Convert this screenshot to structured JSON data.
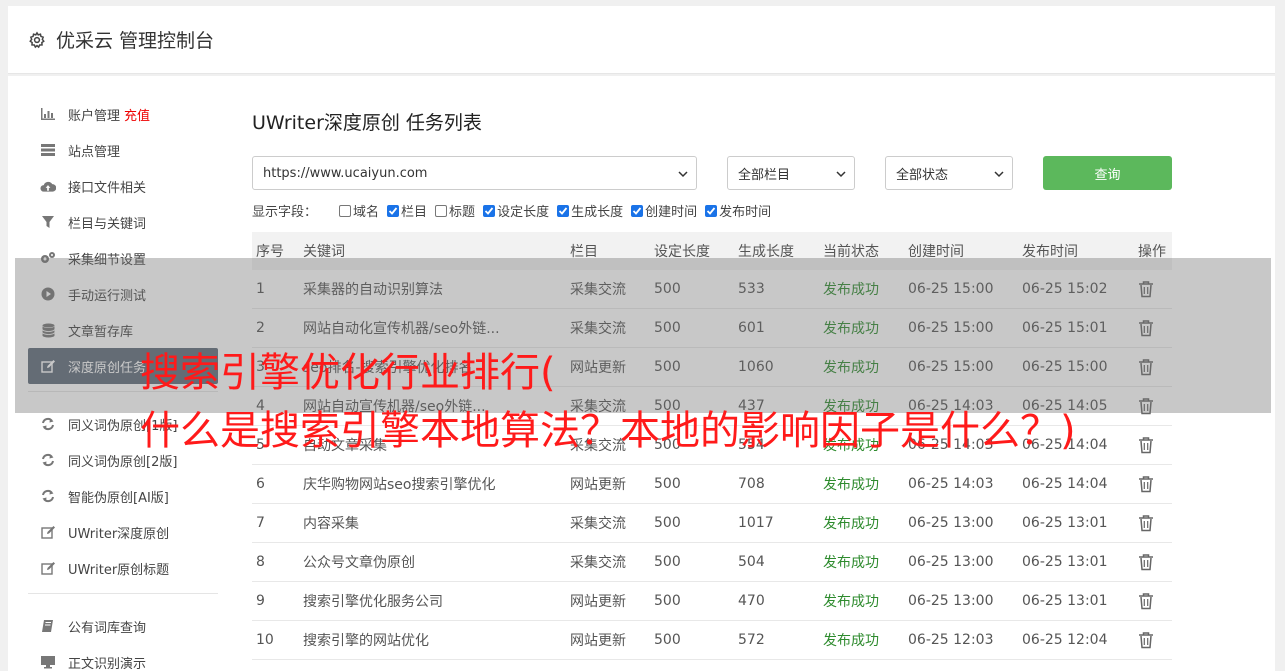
{
  "header": {
    "title": "优采云 管理控制台",
    "icon": "gear-icon"
  },
  "sidebar": {
    "items": [
      {
        "label": "账户管理",
        "extra": "充值",
        "icon": "bar-chart-icon"
      },
      {
        "label": "站点管理",
        "icon": "server-icon"
      },
      {
        "label": "接口文件相关",
        "icon": "cloud-upload-icon"
      },
      {
        "label": "栏目与关键词",
        "icon": "filter-icon"
      },
      {
        "label": "采集细节设置",
        "icon": "cogs-icon"
      },
      {
        "label": "手动运行测试",
        "icon": "play-circle-icon"
      },
      {
        "label": "文章暂存库",
        "icon": "database-icon"
      },
      {
        "label": "深度原创任务",
        "icon": "edit-icon",
        "active": true
      },
      {
        "label": "同义词伪原创[1版]",
        "icon": "refresh-icon"
      },
      {
        "label": "同义词伪原创[2版]",
        "icon": "refresh-icon"
      },
      {
        "label": "智能伪原创[AI版]",
        "icon": "refresh-icon"
      },
      {
        "label": "UWriter深度原创",
        "icon": "edit-icon"
      },
      {
        "label": "UWriter原创标题",
        "icon": "edit-icon"
      },
      {
        "label": "公有词库查询",
        "icon": "book-icon"
      },
      {
        "label": "正文识别演示",
        "icon": "monitor-icon"
      }
    ]
  },
  "main": {
    "title": "UWriter深度原创 任务列表",
    "site_select": "https://www.ucaiyun.com",
    "column_select": "全部栏目",
    "status_select": "全部状态",
    "query_button": "查询",
    "fields_label": "显示字段：",
    "fields": [
      {
        "label": "域名",
        "checked": false
      },
      {
        "label": "栏目",
        "checked": true
      },
      {
        "label": "标题",
        "checked": false
      },
      {
        "label": "设定长度",
        "checked": true
      },
      {
        "label": "生成长度",
        "checked": true
      },
      {
        "label": "创建时间",
        "checked": true
      },
      {
        "label": "发布时间",
        "checked": true
      }
    ],
    "table": {
      "headers": [
        "序号",
        "关键词",
        "栏目",
        "设定长度",
        "生成长度",
        "当前状态",
        "创建时间",
        "发布时间",
        "操作"
      ],
      "rows": [
        [
          "1",
          "采集器的自动识别算法",
          "采集交流",
          "500",
          "533",
          "发布成功",
          "06-25 15:00",
          "06-25 15:02"
        ],
        [
          "2",
          "网站自动化宣传机器/seo外链...",
          "采集交流",
          "500",
          "601",
          "发布成功",
          "06-25 15:00",
          "06-25 15:01"
        ],
        [
          "3",
          "seo排名-搜索引擎优化排名",
          "网站更新",
          "500",
          "1060",
          "发布成功",
          "06-25 15:00",
          "06-25 15:00"
        ],
        [
          "4",
          "网站自动宣传机器/seo外链...",
          "采集交流",
          "500",
          "437",
          "发布成功",
          "06-25 14:03",
          "06-25 14:05"
        ],
        [
          "5",
          "自动文章采集",
          "采集交流",
          "500",
          "554",
          "发布成功",
          "06-25 14:03",
          "06-25 14:04"
        ],
        [
          "6",
          "庆华购物网站seo搜索引擎优化",
          "网站更新",
          "500",
          "708",
          "发布成功",
          "06-25 14:03",
          "06-25 14:04"
        ],
        [
          "7",
          "内容采集",
          "采集交流",
          "500",
          "1017",
          "发布成功",
          "06-25 13:00",
          "06-25 13:01"
        ],
        [
          "8",
          "公众号文章伪原创",
          "采集交流",
          "500",
          "504",
          "发布成功",
          "06-25 13:00",
          "06-25 13:01"
        ],
        [
          "9",
          "搜索引擎优化服务公司",
          "网站更新",
          "500",
          "470",
          "发布成功",
          "06-25 13:00",
          "06-25 13:01"
        ],
        [
          "10",
          "搜索引擎的网站优化",
          "网站更新",
          "500",
          "572",
          "发布成功",
          "06-25 12:03",
          "06-25 12:04"
        ]
      ]
    }
  },
  "overlay": {
    "line1": "搜索引擎优化行业排行(",
    "line2": "什么是搜索引擎本地算法？本地的影响因子是什么？)"
  },
  "colors": {
    "success": "#2e8b2e",
    "query_button": "#5cb85c",
    "active_sidebar": "#5e6b7a",
    "overlay_text": "#ff1a1a"
  }
}
